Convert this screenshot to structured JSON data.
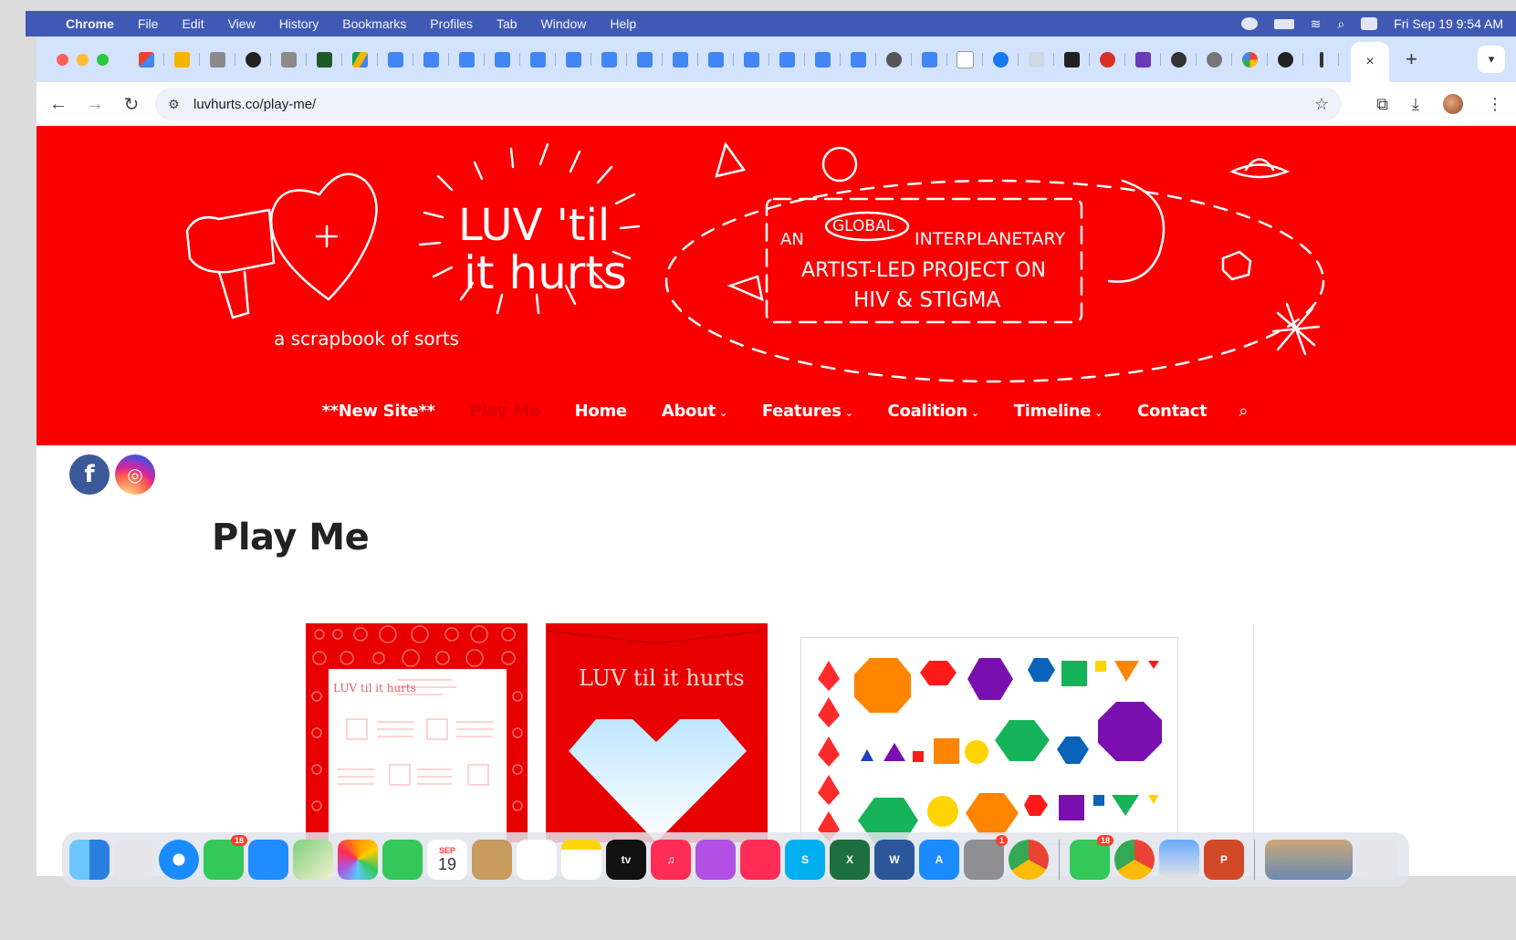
{
  "menubar": {
    "app_name": "Chrome",
    "items": [
      "File",
      "Edit",
      "View",
      "History",
      "Bookmarks",
      "Profiles",
      "Tab",
      "Window",
      "Help"
    ],
    "clock": "Fri Sep 19  9:54 AM"
  },
  "browser": {
    "active_tab_close": "×",
    "new_tab": "+",
    "url": "luvhurts.co/play-me/"
  },
  "site": {
    "logo_text_line1": "LUV 'til",
    "logo_text_line2": "it hurts",
    "tagline": "a scrapbook of sorts",
    "project_word_an": "AN",
    "project_word_global": "GLOBAL",
    "project_line1": "INTERPLANETARY",
    "project_line2": "ARTIST-LED PROJECT ON",
    "project_line3": "HIV & STIGMA",
    "nav": {
      "new_site": "**New Site**",
      "play_me": "Play Me",
      "home": "Home",
      "about": "About",
      "features": "Features",
      "coalition": "Coalition",
      "timeline": "Timeline",
      "contact": "Contact",
      "caret": "⌄"
    },
    "page_title": "Play Me",
    "card1_text": "LUV til it hurts",
    "card2_text": "LUV til it hurts"
  },
  "dock": {
    "calendar_month": "SEP",
    "calendar_day": "19",
    "messages_badge": "18",
    "settings_badge": "1",
    "messages2_badge": "18",
    "tv_label": "tv"
  },
  "colors": {
    "brand_red": "#fa0000",
    "nav_current": "#d90000",
    "menubar": "#3f59b4",
    "tabstrip": "#d3e3fd"
  }
}
